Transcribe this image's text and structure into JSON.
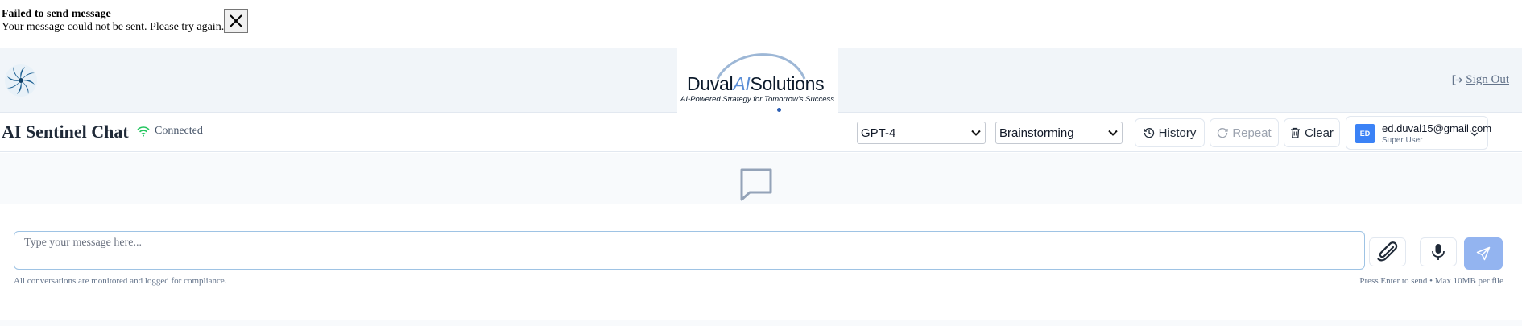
{
  "toast": {
    "title": "Failed to send message",
    "description": "Your message could not be sent. Please try again.",
    "close_icon": "close-icon"
  },
  "header": {
    "app_logo_icon": "spiral-logo-icon",
    "brand": {
      "name_part1": "Duval",
      "name_part2": "AI",
      "name_part3": "Solutions",
      "tagline": "AI-Powered Strategy for Tomorrow's Success."
    },
    "sign_out_label": "Sign Out",
    "sign_out_icon": "sign-out-icon"
  },
  "toolbar": {
    "title": "AI Sentinel Chat",
    "connection_status": "Connected",
    "connection_icon": "wifi-icon",
    "model_select": {
      "value": "GPT-4"
    },
    "mode_select": {
      "value": "Brainstorming"
    },
    "history_label": "History",
    "repeat_label": "Repeat",
    "clear_label": "Clear",
    "user": {
      "initials": "ED",
      "email": "ed.duval15@gmail.com",
      "role": "Super User"
    }
  },
  "messages": {
    "empty_icon": "chat-bubble-icon"
  },
  "composer": {
    "placeholder": "Type your message here...",
    "footer_left": "All conversations are monitored and logged for compliance.",
    "footer_right": "Press Enter to send • Max 10MB per file",
    "attach_icon": "paperclip-icon",
    "mic_icon": "microphone-icon",
    "send_icon": "send-icon"
  },
  "colors": {
    "accent": "#3b82f6",
    "send_button": "#93b4f0",
    "connected": "#22c55e",
    "header_bg": "#f1f5f9"
  }
}
